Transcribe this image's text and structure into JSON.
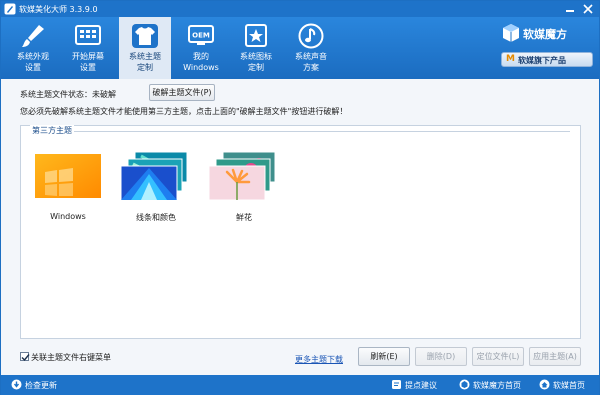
{
  "window": {
    "title": "软媒美化大师 3.3.9.0",
    "accent": "#1e73c9"
  },
  "toolbar": {
    "items": [
      {
        "label": "系统外观\n设置",
        "icon": "brush-icon"
      },
      {
        "label": "开始屏幕\n设置",
        "icon": "start-screen-icon"
      },
      {
        "label": "系统主题\n定制",
        "icon": "tshirt-icon",
        "active": true
      },
      {
        "label": "我的\nWindows",
        "icon": "oem-icon"
      },
      {
        "label": "系统图标\n定制",
        "icon": "star-icon"
      },
      {
        "label": "系统声音\n方案",
        "icon": "music-note-icon"
      }
    ],
    "brand": "软媒魔方",
    "brand_link": {
      "logo": "M",
      "label": "软媒旗下产品"
    }
  },
  "status": {
    "label": "系统主题文件状态：未破解",
    "crack_button": "破解主题文件(P)",
    "hint": "您必须先破解系统主题文件才能使用第三方主题，点击上面的\"破解主题文件\"按钮进行破解！"
  },
  "themes": {
    "group_title": "第三方主题",
    "items": [
      {
        "name": "Windows"
      },
      {
        "name": "线条和颜色"
      },
      {
        "name": "鲜花"
      }
    ]
  },
  "bottom": {
    "assoc_label": "关联主题文件右键菜单",
    "assoc_checked": true,
    "more_link": "更多主题下载",
    "buttons": {
      "refresh": "刷新(E)",
      "delete": "删除(D)",
      "locate": "定位文件(L)",
      "apply": "应用主题(A)"
    }
  },
  "footer": {
    "check_update": "检查更新",
    "feedback": "提点建议",
    "mofang_home": "软媒魔方首页",
    "ruanmei_home": "软媒首页"
  }
}
